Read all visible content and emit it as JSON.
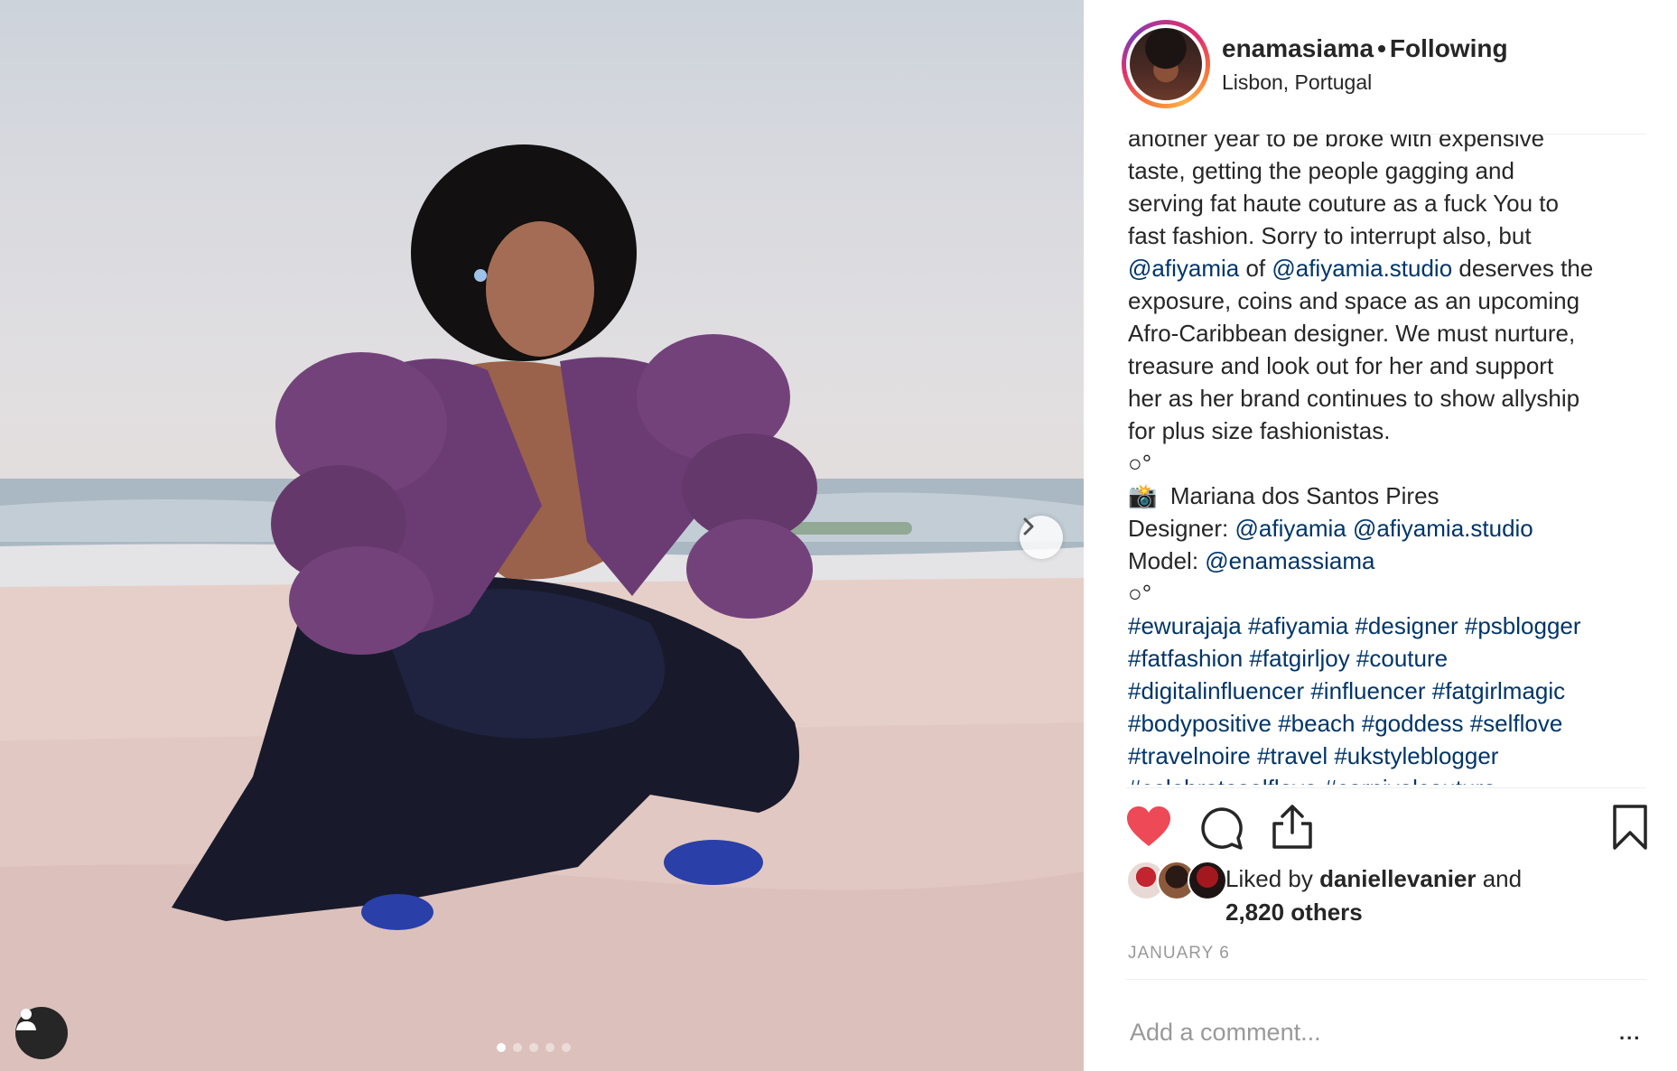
{
  "post": {
    "username": "enamasiama",
    "follow_status": "Following",
    "location": "Lisbon, Portugal"
  },
  "caption": {
    "lines": [
      "another year to be broke with expensive",
      "taste, getting the people gagging and",
      "serving fat haute couture as a fuck You to",
      "fast fashion. Sorry to interrupt also, but"
    ],
    "mention1": "@afiyamia",
    "of": " of ",
    "mention2": "@afiyamia.studio",
    "after_mentions": " deserves the",
    "lines2": [
      "exposure, coins and space as an upcoming",
      "Afro-Caribbean designer. We must nurture,",
      "treasure and look out for her and support",
      "her as her brand continues to show allyship",
      "for plus size fashionistas."
    ],
    "separator": "○°",
    "camera_emoji": "📸",
    "photographer": "Mariana dos Santos Pires",
    "designer_label": "Designer: ",
    "designer_1": "@afiyamia",
    "designer_2": "@afiyamia.studio",
    "model_label": "Model: ",
    "model": "@enamassiama",
    "hashtag_lines": [
      "#ewurajaja #afiyamia #designer #psblogger",
      "#fatfashion #fatgirljoy #couture",
      "#digitalinfluencer #influencer #fatgirlmagic",
      "#bodypositive #beach #goddess #selflove",
      "#travelnoire #travel #ukstyleblogger",
      "#celebrateselflove #carnivalcouture"
    ]
  },
  "likes": {
    "prefix": "Liked by ",
    "user": "daniellevanier",
    "and": " and",
    "others": "2,820 others"
  },
  "date": "JANUARY 6",
  "comment": {
    "placeholder": "Add a comment...",
    "more_label": "..."
  },
  "carousel": {
    "total_slides": 5,
    "active_slide": 1
  },
  "colors": {
    "like_red": "#ed4956",
    "link_blue": "#003569",
    "muted": "#999999"
  },
  "icons": [
    "heart-icon",
    "comment-icon",
    "share-icon",
    "bookmark-icon",
    "chevron-right-icon",
    "person-tag-icon"
  ]
}
